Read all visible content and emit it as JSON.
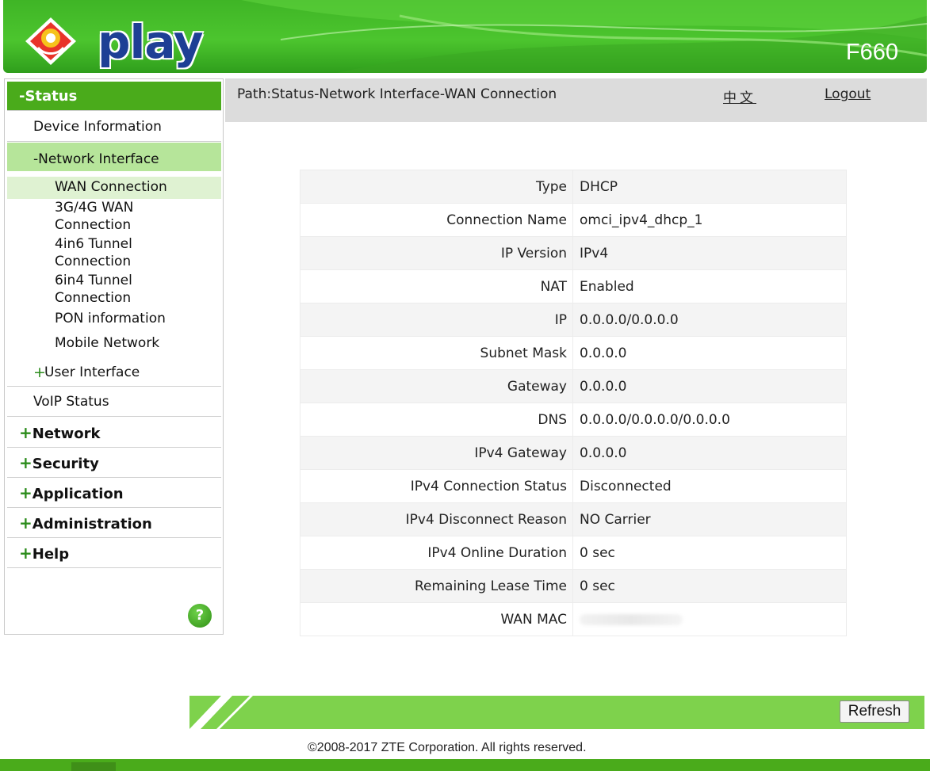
{
  "header": {
    "brand": "play",
    "model": "F660"
  },
  "sidebar": {
    "status": "-Status",
    "device_information": "Device Information",
    "network_interface": "-Network Interface",
    "wan_connection": "WAN Connection",
    "wan_3g4g_line1": "3G/4G WAN",
    "wan_3g4g_line2": "Connection",
    "tunnel_4in6_line1": "4in6 Tunnel",
    "tunnel_4in6_line2": "Connection",
    "tunnel_6in4_line1": "6in4 Tunnel",
    "tunnel_6in4_line2": "Connection",
    "pon_information": "PON information",
    "mobile_network": "Mobile Network",
    "user_interface": "User Interface",
    "voip_status": "VoIP Status",
    "network": "Network",
    "security": "Security",
    "application": "Application",
    "administration": "Administration",
    "help": "Help",
    "help_icon_glyph": "?"
  },
  "pathbar": {
    "path": "Path:Status-Network Interface-WAN Connection",
    "language": "中文",
    "logout": "Logout"
  },
  "wan_info": {
    "rows": [
      {
        "label": "Type",
        "value": "DHCP"
      },
      {
        "label": "Connection Name",
        "value": "omci_ipv4_dhcp_1"
      },
      {
        "label": "IP Version",
        "value": "IPv4"
      },
      {
        "label": "NAT",
        "value": "Enabled"
      },
      {
        "label": "IP",
        "value": "0.0.0.0/0.0.0.0"
      },
      {
        "label": "Subnet Mask",
        "value": "0.0.0.0"
      },
      {
        "label": "Gateway",
        "value": "0.0.0.0"
      },
      {
        "label": "DNS",
        "value": "0.0.0.0/0.0.0.0/0.0.0.0"
      },
      {
        "label": "IPv4 Gateway",
        "value": "0.0.0.0"
      },
      {
        "label": "IPv4 Connection Status",
        "value": "Disconnected"
      },
      {
        "label": "IPv4 Disconnect Reason",
        "value": "NO Carrier"
      },
      {
        "label": "IPv4 Online Duration",
        "value": "0 sec"
      },
      {
        "label": "Remaining Lease Time",
        "value": "0 sec"
      },
      {
        "label": "WAN MAC",
        "value": ""
      }
    ]
  },
  "footer": {
    "refresh": "Refresh",
    "copyright": "©2008-2017 ZTE Corporation. All rights reserved."
  },
  "colors": {
    "header_green": "#4cc52e",
    "menu_active": "#4aab1b",
    "submenu_active": "#b6e59a",
    "submenu_selected": "#dff2d2",
    "footer_green": "#7ed24c",
    "logo_blue": "#1e3f95"
  }
}
